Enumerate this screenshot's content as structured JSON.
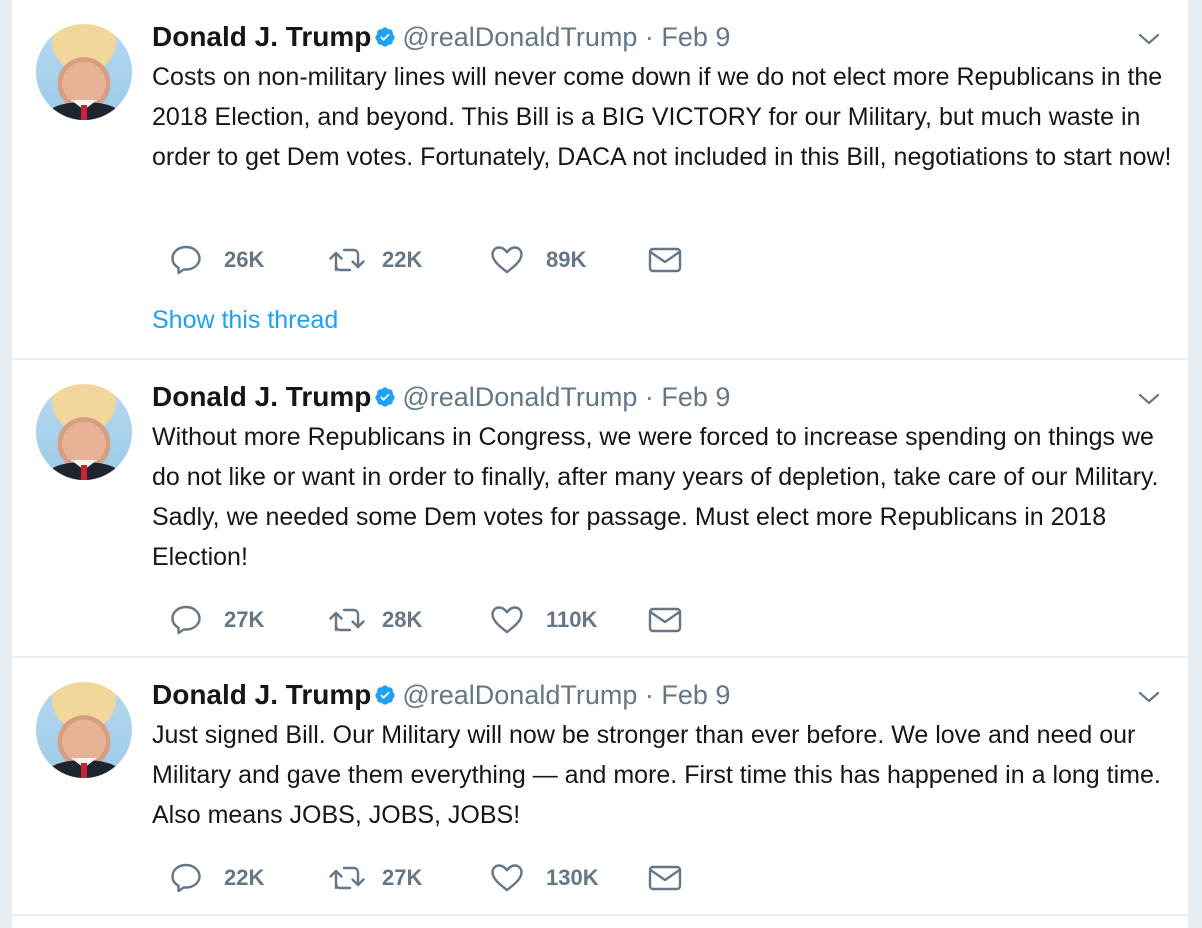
{
  "tweets": [
    {
      "name": "Donald J. Trump",
      "handle": "@realDonaldTrump",
      "separator": "·",
      "date": "Feb 9",
      "text": "Costs on non-military lines will never come down if we do not elect more Republicans in the 2018 Election, and beyond. This Bill is a BIG VICTORY for our Military, but much waste in order to get Dem votes. Fortunately, DACA not included in this Bill, negotiations to start now!",
      "replies": "26K",
      "retweets": "22K",
      "likes": "89K",
      "thread_link": "Show this thread"
    },
    {
      "name": "Donald J. Trump",
      "handle": "@realDonaldTrump",
      "separator": "·",
      "date": "Feb 9",
      "text": "Without more Republicans in Congress, we were forced to increase spending on things we do not like or want in order to finally, after many years of depletion, take care of our Military. Sadly, we needed some Dem votes for passage. Must elect more Republicans in 2018 Election!",
      "replies": "27K",
      "retweets": "28K",
      "likes": "110K"
    },
    {
      "name": "Donald J. Trump",
      "handle": "@realDonaldTrump",
      "separator": "·",
      "date": "Feb 9",
      "text": "Just signed Bill. Our Military will now be stronger than ever before. We love and need our Military and gave them everything — and more. First time this has happened in a long time. Also means JOBS, JOBS, JOBS!",
      "replies": "22K",
      "retweets": "27K",
      "likes": "130K"
    }
  ],
  "icons": {
    "reply": "reply-icon",
    "retweet": "retweet-icon",
    "like": "heart-icon",
    "dm": "envelope-icon",
    "verified": "verified-badge-icon",
    "caret": "chevron-down-icon"
  },
  "colors": {
    "link": "#1da1f2",
    "muted": "#657786",
    "text": "#14171a",
    "background": "#e6ecf0"
  }
}
